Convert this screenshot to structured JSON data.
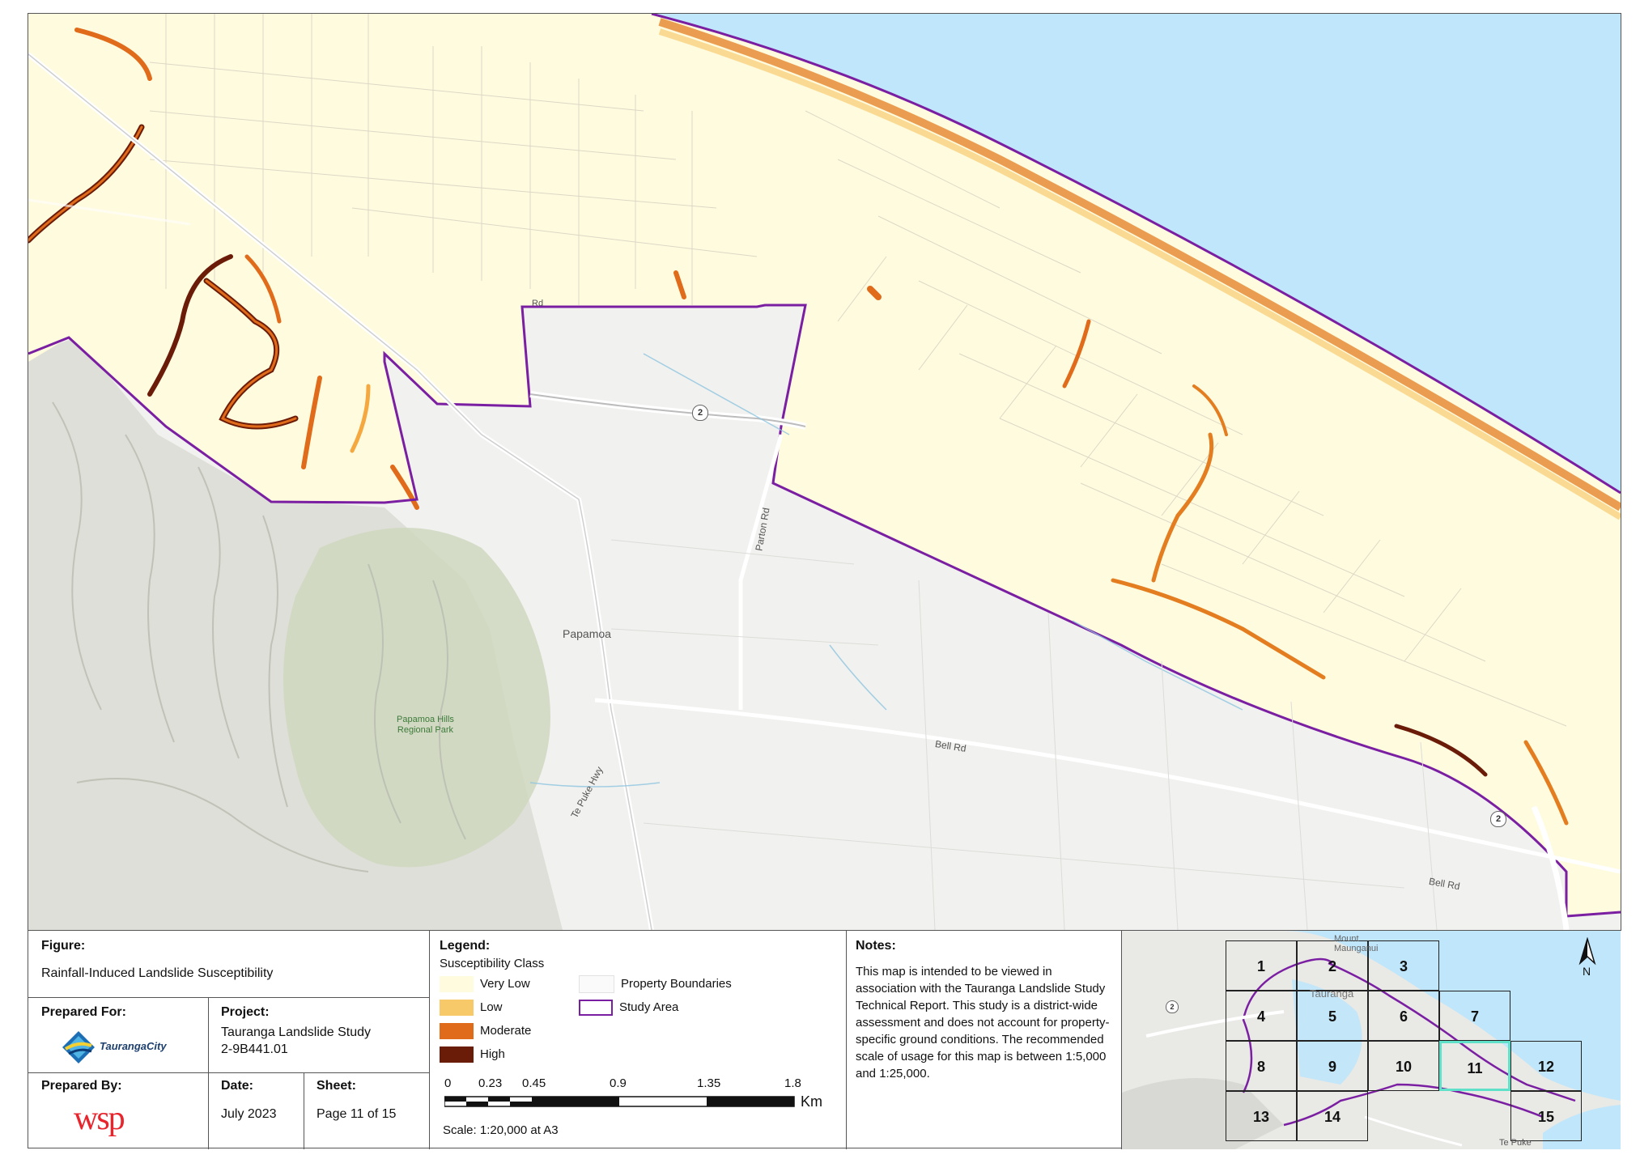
{
  "map": {
    "labels": {
      "papamoa": "Papamoa",
      "park": "Papamoa Hills\nRegional Park",
      "parton_rd": "Parton Rd",
      "bell_rd_1": "Bell Rd",
      "bell_rd_2": "Bell Rd",
      "te_puke_hwy": "Te Puke Hwy",
      "rd_fragment": "Rd",
      "highway_shield_1": "2",
      "highway_shield_2": "2"
    },
    "colors": {
      "sea": "#bfe6fb",
      "susceptible_land": "#fffbdf",
      "background": "#f1f1ef",
      "study_area": "#7b1fa2",
      "hills": "#cfd8bf"
    }
  },
  "figure": {
    "label": "Figure:",
    "title": "Rainfall-Induced Landslide Susceptibility"
  },
  "prepared_for": {
    "label": "Prepared For:",
    "logo_text": "TaurangaCity"
  },
  "project": {
    "label": "Project:",
    "name": "Tauranga Landslide Study",
    "number": "2-9B441.01"
  },
  "prepared_by": {
    "label": "Prepared By:",
    "logo_text": "wsp"
  },
  "date": {
    "label": "Date:",
    "value": "July 2023"
  },
  "sheet": {
    "label": "Sheet:",
    "value": "Page 11 of 15"
  },
  "legend": {
    "title": "Legend:",
    "subtitle": "Susceptibility Class",
    "items": [
      {
        "label": "Very Low",
        "color": "#fffbdf"
      },
      {
        "label": "Low",
        "color": "#f8c969"
      },
      {
        "label": "Moderate",
        "color": "#e06b1b"
      },
      {
        "label": "High",
        "color": "#6b1c08"
      }
    ],
    "property_boundaries": "Property Boundaries",
    "study_area": "Study Area",
    "scale_ticks": [
      "0",
      "0.23",
      "0.45",
      "0.9",
      "1.35",
      "1.8"
    ],
    "scale_unit": "Km",
    "scale_text": "Scale: 1:20,000 at A3"
  },
  "notes": {
    "title": "Notes:",
    "body": "This map is intended to be viewed in association with the Tauranga Landslide Study Technical Report. This study is a district-wide assessment and does not account for property-specific ground conditions. The recommended scale of usage for this map is between 1:5,000 and 1:25,000."
  },
  "inset": {
    "sheets": [
      "1",
      "2",
      "3",
      "4",
      "5",
      "6",
      "7",
      "8",
      "9",
      "10",
      "11",
      "12",
      "13",
      "14",
      "15"
    ],
    "highlighted_sheet": "11",
    "place_labels": {
      "mount": "Mount\nMaunganui",
      "tauranga": "Tauranga",
      "te_puke": "Te Puke"
    },
    "north": "N",
    "shield": "2"
  }
}
